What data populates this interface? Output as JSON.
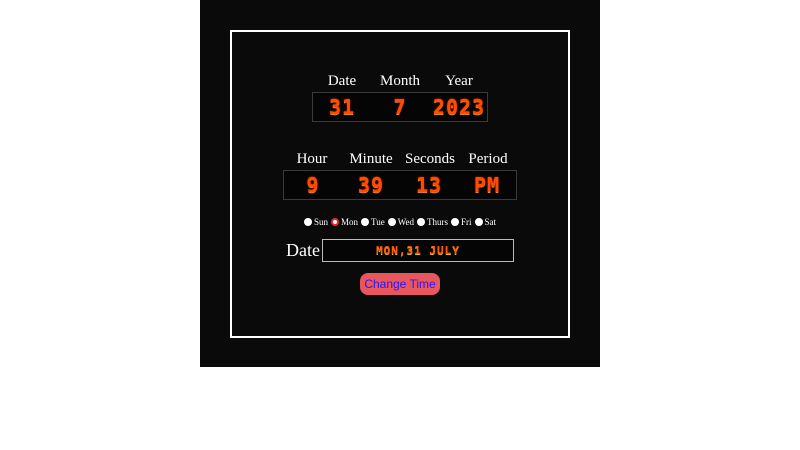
{
  "date_labels": {
    "date": "Date",
    "month": "Month",
    "year": "Year"
  },
  "date_values": {
    "date": "31",
    "month": "7",
    "year": "2023"
  },
  "time_labels": {
    "hour": "Hour",
    "minute": "Minute",
    "seconds": "Seconds",
    "period": "Period"
  },
  "time_values": {
    "hour": "9",
    "minute": "39",
    "seconds": "13",
    "period": "PM"
  },
  "days": [
    {
      "label": "Sun",
      "checked": false
    },
    {
      "label": "Mon",
      "checked": true
    },
    {
      "label": "Tue",
      "checked": false
    },
    {
      "label": "Wed",
      "checked": false
    },
    {
      "label": "Thurs",
      "checked": false
    },
    {
      "label": "Fri",
      "checked": false
    },
    {
      "label": "Sat",
      "checked": false
    }
  ],
  "date_field": {
    "label": "Date",
    "value": "MON,31 JULY"
  },
  "button": {
    "label": "Change Time"
  },
  "colors": {
    "background": "#0a0a0a",
    "digit": "#ff4a00",
    "button": "#e8565e",
    "button_text": "#2a14ff"
  }
}
